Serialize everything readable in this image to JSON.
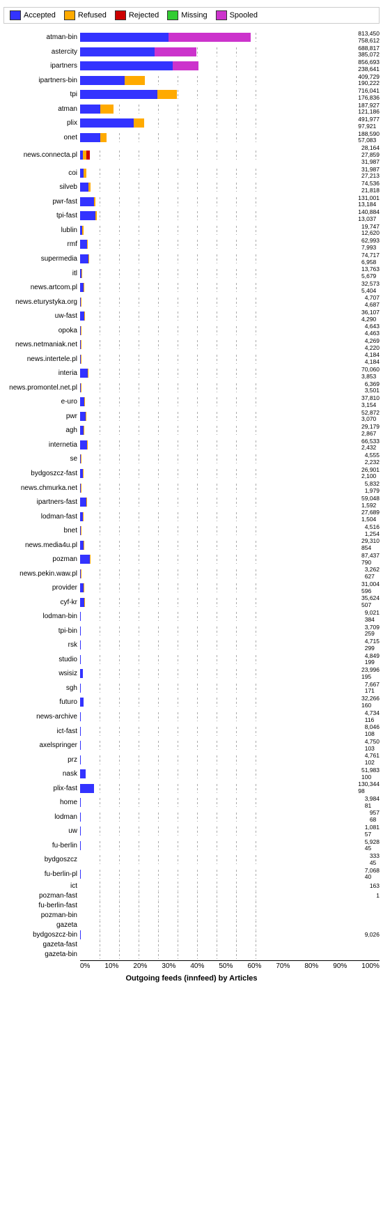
{
  "title": "Outgoing feeds (innfeed) by Articles",
  "legend": [
    {
      "label": "Accepted",
      "color": "#3333ff"
    },
    {
      "label": "Refused",
      "color": "#ffaa00"
    },
    {
      "label": "Rejected",
      "color": "#cc0000"
    },
    {
      "label": "Missing",
      "color": "#33cc33"
    },
    {
      "label": "Spooled",
      "color": "#cc33cc"
    }
  ],
  "xaxis": [
    "0%",
    "10%",
    "20%",
    "30%",
    "40%",
    "50%",
    "60%",
    "70%",
    "80%",
    "90%",
    "100%"
  ],
  "max_val": 1800000,
  "rows": [
    {
      "label": "atman-bin",
      "vals": [
        813450,
        0,
        0,
        0,
        758612
      ],
      "pcts": [
        45.2,
        0,
        0,
        0,
        42.1
      ]
    },
    {
      "label": "astercity",
      "vals": [
        688817,
        0,
        0,
        0,
        385072
      ],
      "pcts": [
        38.3,
        0,
        0,
        0,
        21.4
      ]
    },
    {
      "label": "ipartners",
      "vals": [
        856693,
        0,
        0,
        0,
        238641
      ],
      "pcts": [
        47.6,
        0,
        0,
        0,
        13.3
      ]
    },
    {
      "label": "ipartners-bin",
      "vals": [
        409729,
        190222,
        0,
        0,
        0
      ],
      "pcts": [
        22.8,
        10.6,
        0,
        0,
        0
      ]
    },
    {
      "label": "tpi",
      "vals": [
        716041,
        176836,
        0,
        0,
        0
      ],
      "pcts": [
        39.8,
        9.8,
        0,
        0,
        0
      ]
    },
    {
      "label": "atman",
      "vals": [
        187927,
        121186,
        0,
        0,
        0
      ],
      "pcts": [
        10.4,
        6.7,
        0,
        0,
        0
      ]
    },
    {
      "label": "plix",
      "vals": [
        491977,
        97921,
        0,
        0,
        0
      ],
      "pcts": [
        27.3,
        5.4,
        0,
        0,
        0
      ]
    },
    {
      "label": "onet",
      "vals": [
        188590,
        57083,
        0,
        0,
        0
      ],
      "pcts": [
        10.5,
        3.2,
        0,
        0,
        0
      ]
    },
    {
      "label": "news.connecta.pl",
      "vals": [
        28164,
        27859,
        31987,
        0,
        0
      ],
      "pcts": [
        1.6,
        1.5,
        1.8,
        0,
        0
      ]
    },
    {
      "label": "coi",
      "vals": [
        31987,
        27213,
        0,
        0,
        0
      ],
      "pcts": [
        1.8,
        1.5,
        0,
        0,
        0
      ]
    },
    {
      "label": "silveb",
      "vals": [
        74536,
        21818,
        0,
        0,
        0
      ],
      "pcts": [
        4.1,
        1.2,
        0,
        0,
        0
      ]
    },
    {
      "label": "pwr-fast",
      "vals": [
        131001,
        13184,
        0,
        0,
        0
      ],
      "pcts": [
        7.3,
        0.7,
        0,
        0,
        0
      ]
    },
    {
      "label": "tpi-fast",
      "vals": [
        140884,
        13037,
        0,
        0,
        0
      ],
      "pcts": [
        7.8,
        0.7,
        0,
        0,
        0
      ]
    },
    {
      "label": "lublin",
      "vals": [
        19747,
        12620,
        0,
        0,
        0
      ],
      "pcts": [
        1.1,
        0.7,
        0,
        0,
        0
      ]
    },
    {
      "label": "rmf",
      "vals": [
        62993,
        7993,
        0,
        0,
        0
      ],
      "pcts": [
        3.5,
        0.4,
        0,
        0,
        0
      ]
    },
    {
      "label": "supermedia",
      "vals": [
        74717,
        6958,
        0,
        0,
        0
      ],
      "pcts": [
        4.2,
        0.4,
        0,
        0,
        0
      ]
    },
    {
      "label": "itl",
      "vals": [
        13763,
        5679,
        0,
        0,
        0
      ],
      "pcts": [
        0.8,
        0.3,
        0,
        0,
        0
      ]
    },
    {
      "label": "news.artcom.pl",
      "vals": [
        32573,
        5404,
        0,
        0,
        0
      ],
      "pcts": [
        1.8,
        0.3,
        0,
        0,
        0
      ]
    },
    {
      "label": "news.eturystyka.org",
      "vals": [
        4707,
        4687,
        0,
        0,
        0
      ],
      "pcts": [
        0.3,
        0.3,
        0,
        0,
        0
      ]
    },
    {
      "label": "uw-fast",
      "vals": [
        36107,
        4290,
        0,
        0,
        0
      ],
      "pcts": [
        2.0,
        0.2,
        0,
        0,
        0
      ]
    },
    {
      "label": "opoka",
      "vals": [
        4643,
        4463,
        0,
        0,
        0
      ],
      "pcts": [
        0.3,
        0.2,
        0,
        0,
        0
      ]
    },
    {
      "label": "news.netmaniak.net",
      "vals": [
        4269,
        4220,
        0,
        0,
        0
      ],
      "pcts": [
        0.2,
        0.2,
        0,
        0,
        0
      ]
    },
    {
      "label": "news.intertele.pl",
      "vals": [
        4184,
        4184,
        0,
        0,
        0
      ],
      "pcts": [
        0.2,
        0.2,
        0,
        0,
        0
      ]
    },
    {
      "label": "interia",
      "vals": [
        70060,
        3853,
        0,
        0,
        0
      ],
      "pcts": [
        3.9,
        0.2,
        0,
        0,
        0
      ]
    },
    {
      "label": "news.promontel.net.pl",
      "vals": [
        6369,
        3501,
        0,
        0,
        0
      ],
      "pcts": [
        0.4,
        0.2,
        0,
        0,
        0
      ]
    },
    {
      "label": "e-uro",
      "vals": [
        37810,
        3154,
        0,
        0,
        0
      ],
      "pcts": [
        2.1,
        0.2,
        0,
        0,
        0
      ]
    },
    {
      "label": "pwr",
      "vals": [
        52872,
        3070,
        0,
        0,
        0
      ],
      "pcts": [
        2.9,
        0.2,
        0,
        0,
        0
      ]
    },
    {
      "label": "agh",
      "vals": [
        29179,
        2867,
        0,
        0,
        0
      ],
      "pcts": [
        1.6,
        0.2,
        0,
        0,
        0
      ]
    },
    {
      "label": "internetia",
      "vals": [
        66533,
        2432,
        0,
        0,
        0
      ],
      "pcts": [
        3.7,
        0.1,
        0,
        0,
        0
      ]
    },
    {
      "label": "se",
      "vals": [
        4555,
        2232,
        0,
        0,
        0
      ],
      "pcts": [
        0.3,
        0.1,
        0,
        0,
        0
      ]
    },
    {
      "label": "bydgoszcz-fast",
      "vals": [
        26901,
        2100,
        0,
        0,
        0
      ],
      "pcts": [
        1.5,
        0.1,
        0,
        0,
        0
      ]
    },
    {
      "label": "news.chmurka.net",
      "vals": [
        5832,
        1979,
        0,
        0,
        0
      ],
      "pcts": [
        0.3,
        0.1,
        0,
        0,
        0
      ]
    },
    {
      "label": "ipartners-fast",
      "vals": [
        59048,
        1592,
        0,
        0,
        0
      ],
      "pcts": [
        3.3,
        0.1,
        0,
        0,
        0
      ]
    },
    {
      "label": "lodman-fast",
      "vals": [
        27689,
        1504,
        0,
        0,
        0
      ],
      "pcts": [
        1.5,
        0.1,
        0,
        0,
        0
      ]
    },
    {
      "label": "bnet",
      "vals": [
        4516,
        1254,
        0,
        0,
        0
      ],
      "pcts": [
        0.3,
        0.1,
        0,
        0,
        0
      ]
    },
    {
      "label": "news.media4u.pl",
      "vals": [
        29310,
        854,
        0,
        0,
        0
      ],
      "pcts": [
        1.6,
        0.05,
        0,
        0,
        0
      ]
    },
    {
      "label": "pozman",
      "vals": [
        87437,
        790,
        0,
        0,
        0
      ],
      "pcts": [
        4.9,
        0.04,
        0,
        0,
        0
      ]
    },
    {
      "label": "news.pekin.waw.pl",
      "vals": [
        3262,
        627,
        0,
        0,
        0
      ],
      "pcts": [
        0.2,
        0.03,
        0,
        0,
        0
      ]
    },
    {
      "label": "provider",
      "vals": [
        31004,
        596,
        0,
        0,
        0
      ],
      "pcts": [
        1.7,
        0.03,
        0,
        0,
        0
      ]
    },
    {
      "label": "cyf-kr",
      "vals": [
        35624,
        507,
        0,
        0,
        0
      ],
      "pcts": [
        2.0,
        0.03,
        0,
        0,
        0
      ]
    },
    {
      "label": "lodman-bin",
      "vals": [
        9021,
        384,
        0,
        0,
        0
      ],
      "pcts": [
        0.5,
        0.02,
        0,
        0,
        0
      ]
    },
    {
      "label": "tpi-bin",
      "vals": [
        3709,
        259,
        0,
        0,
        0
      ],
      "pcts": [
        0.2,
        0.01,
        0,
        0,
        0
      ]
    },
    {
      "label": "rsk",
      "vals": [
        4715,
        299,
        0,
        0,
        0
      ],
      "pcts": [
        0.3,
        0.02,
        0,
        0,
        0
      ]
    },
    {
      "label": "studio",
      "vals": [
        4849,
        199,
        0,
        0,
        0
      ],
      "pcts": [
        0.3,
        0.01,
        0,
        0,
        0
      ]
    },
    {
      "label": "wsisiz",
      "vals": [
        23996,
        195,
        0,
        0,
        0
      ],
      "pcts": [
        1.3,
        0.01,
        0,
        0,
        0
      ]
    },
    {
      "label": "sgh",
      "vals": [
        7667,
        171,
        0,
        0,
        0
      ],
      "pcts": [
        0.4,
        0.01,
        0,
        0,
        0
      ]
    },
    {
      "label": "futuro",
      "vals": [
        32266,
        160,
        0,
        0,
        0
      ],
      "pcts": [
        1.8,
        0.01,
        0,
        0,
        0
      ]
    },
    {
      "label": "news-archive",
      "vals": [
        4734,
        116,
        0,
        0,
        0
      ],
      "pcts": [
        0.3,
        0.01,
        0,
        0,
        0
      ]
    },
    {
      "label": "ict-fast",
      "vals": [
        8046,
        108,
        0,
        0,
        0
      ],
      "pcts": [
        0.4,
        0.01,
        0,
        0,
        0
      ]
    },
    {
      "label": "axelspringer",
      "vals": [
        4750,
        103,
        0,
        0,
        0
      ],
      "pcts": [
        0.3,
        0.01,
        0,
        0,
        0
      ]
    },
    {
      "label": "prz",
      "vals": [
        4761,
        102,
        0,
        0,
        0
      ],
      "pcts": [
        0.3,
        0.01,
        0,
        0,
        0
      ]
    },
    {
      "label": "nask",
      "vals": [
        51983,
        100,
        0,
        0,
        0
      ],
      "pcts": [
        2.9,
        0.01,
        0,
        0,
        0
      ]
    },
    {
      "label": "plix-fast",
      "vals": [
        130344,
        98,
        0,
        0,
        0
      ],
      "pcts": [
        7.2,
        0.01,
        0,
        0,
        0
      ]
    },
    {
      "label": "home",
      "vals": [
        3984,
        81,
        0,
        0,
        0
      ],
      "pcts": [
        0.2,
        0.004,
        0,
        0,
        0
      ]
    },
    {
      "label": "lodman",
      "vals": [
        957,
        68,
        0,
        0,
        0
      ],
      "pcts": [
        0.05,
        0.004,
        0,
        0,
        0
      ]
    },
    {
      "label": "uw",
      "vals": [
        1081,
        57,
        0,
        0,
        0
      ],
      "pcts": [
        0.06,
        0.003,
        0,
        0,
        0
      ]
    },
    {
      "label": "fu-berlin",
      "vals": [
        5928,
        45,
        0,
        0,
        0
      ],
      "pcts": [
        0.33,
        0.002,
        0,
        0,
        0
      ]
    },
    {
      "label": "bydgoszcz",
      "vals": [
        333,
        45,
        0,
        0,
        0
      ],
      "pcts": [
        0.02,
        0.002,
        0,
        0,
        0
      ]
    },
    {
      "label": "fu-berlin-pl",
      "vals": [
        7068,
        40,
        0,
        0,
        0
      ],
      "pcts": [
        0.39,
        0.002,
        0,
        0,
        0
      ]
    },
    {
      "label": "ict",
      "vals": [
        163,
        0,
        0,
        0,
        0
      ],
      "pcts": [
        0.009,
        0,
        0,
        0,
        0
      ]
    },
    {
      "label": "pozman-fast",
      "vals": [
        1,
        0,
        0,
        0,
        0
      ],
      "pcts": [
        5e-05,
        0,
        0,
        0,
        0
      ]
    },
    {
      "label": "fu-berlin-fast",
      "vals": [
        0,
        0,
        0,
        0,
        0
      ],
      "pcts": [
        0,
        0,
        0,
        0,
        0
      ]
    },
    {
      "label": "pozman-bin",
      "vals": [
        0,
        0,
        0,
        0,
        0
      ],
      "pcts": [
        0,
        0,
        0,
        0,
        0
      ]
    },
    {
      "label": "gazeta",
      "vals": [
        0,
        0,
        0,
        0,
        0
      ],
      "pcts": [
        0,
        0,
        0,
        0,
        0
      ]
    },
    {
      "label": "bydgoszcz-bin",
      "vals": [
        9026,
        0,
        0,
        0,
        0
      ],
      "pcts": [
        0.5,
        0,
        0,
        0,
        0
      ]
    },
    {
      "label": "gazeta-fast",
      "vals": [
        0,
        0,
        0,
        0,
        0
      ],
      "pcts": [
        0,
        0,
        0,
        0,
        0
      ]
    },
    {
      "label": "gazeta-bin",
      "vals": [
        0,
        0,
        0,
        0,
        0
      ],
      "pcts": [
        0,
        0,
        0,
        0,
        0
      ]
    }
  ],
  "colors": [
    "#3333ff",
    "#ffaa00",
    "#cc0000",
    "#33cc33",
    "#cc33cc"
  ]
}
